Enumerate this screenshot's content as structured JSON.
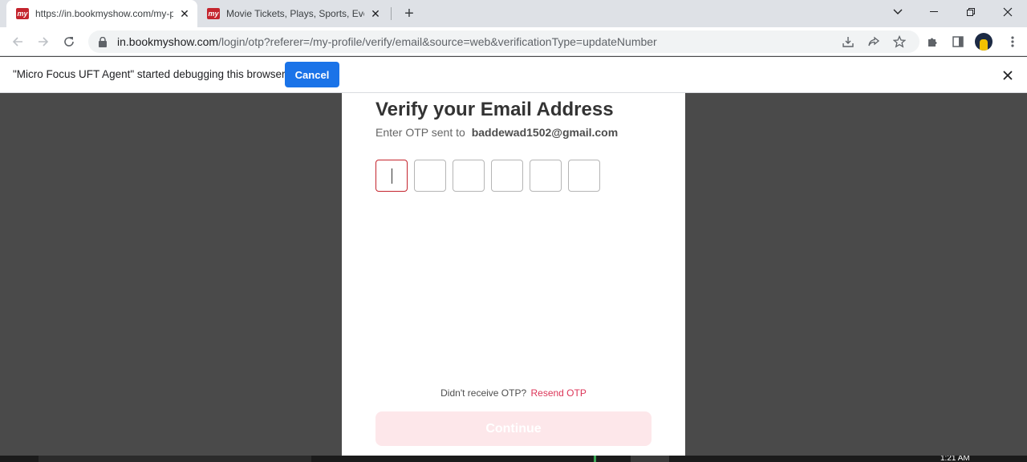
{
  "browser": {
    "tabs": [
      {
        "title": "https://in.bookmyshow.com/my-profile",
        "favicon": "bms-logo",
        "active": true
      },
      {
        "title": "Movie Tickets, Plays, Sports, Events",
        "favicon": "bms-logo",
        "active": false
      }
    ],
    "favicon_text": "my",
    "url_host": "in.bookmyshow.com",
    "url_path": "/login/otp?referer=/my-profile/verify/email&source=web&verificationType=updateNumber"
  },
  "infobar": {
    "message": "\"Micro Focus UFT Agent\" started debugging this browser",
    "cancel_label": "Cancel"
  },
  "modal": {
    "heading": "Verify your Email Address",
    "sub_prefix": "Enter OTP sent to",
    "email": "baddewad1502@gmail.com",
    "otp_digits": 6,
    "resend_prefix": "Didn't receive OTP?",
    "resend_link": "Resend OTP",
    "continue_label": "Continue"
  },
  "taskbar": {
    "clock": "1:21 AM"
  },
  "colors": {
    "brand": "#c4242d",
    "link": "#dc3558",
    "continue_disabled": "#fde7ea",
    "infobar_button": "#1a73e8",
    "backdrop": "#4a4a4a"
  }
}
